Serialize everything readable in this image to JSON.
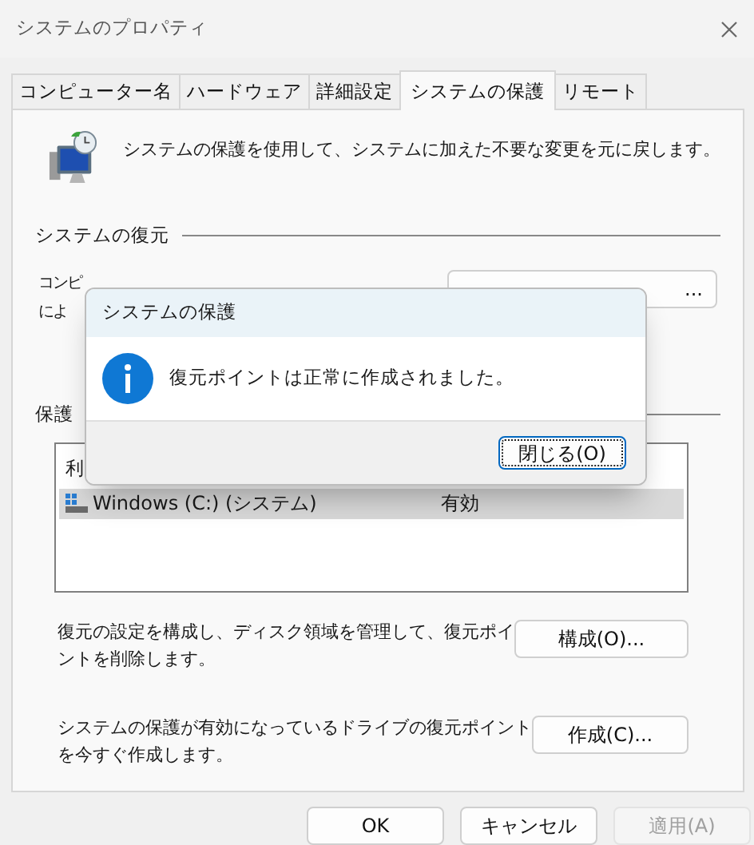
{
  "window": {
    "title": "システムのプロパティ"
  },
  "tabs": [
    {
      "label": "コンピューター名",
      "selected": false
    },
    {
      "label": "ハードウェア",
      "selected": false
    },
    {
      "label": "詳細設定",
      "selected": false
    },
    {
      "label": "システムの保護",
      "selected": true
    },
    {
      "label": "リモート",
      "selected": false
    }
  ],
  "intro": "システムの保護を使用して、システムに加えた不要な変更を元に戻します。",
  "restore_section": {
    "heading": "システムの復元",
    "description_lines": [
      "コンピ",
      "によ"
    ],
    "button": "..."
  },
  "settings_section": {
    "heading": "保護",
    "table": {
      "columns": [
        "利"
      ],
      "rows": [
        {
          "cells": [
            "Windows (C:) (システム)",
            "有効"
          ],
          "selected": true
        }
      ]
    }
  },
  "actions": [
    {
      "lines": [
        "復元の設定を構成し、ディスク領域を管理して、復元ポイ",
        "ントを削除します。"
      ],
      "button": "構成(O)..."
    },
    {
      "lines": [
        "システムの保護が有効になっているドライブの復元ポイント",
        "を今すぐ作成します。"
      ],
      "button": "作成(C)..."
    }
  ],
  "buttons": [
    {
      "label": "OK",
      "disabled": false
    },
    {
      "label": "キャンセル",
      "disabled": false
    },
    {
      "label": "適用(A)",
      "disabled": true
    }
  ],
  "message_box": {
    "title": "システムの保護",
    "message": "復元ポイントは正常に作成されました。",
    "button": {
      "label": "閉じる(O)",
      "focused": true
    }
  }
}
